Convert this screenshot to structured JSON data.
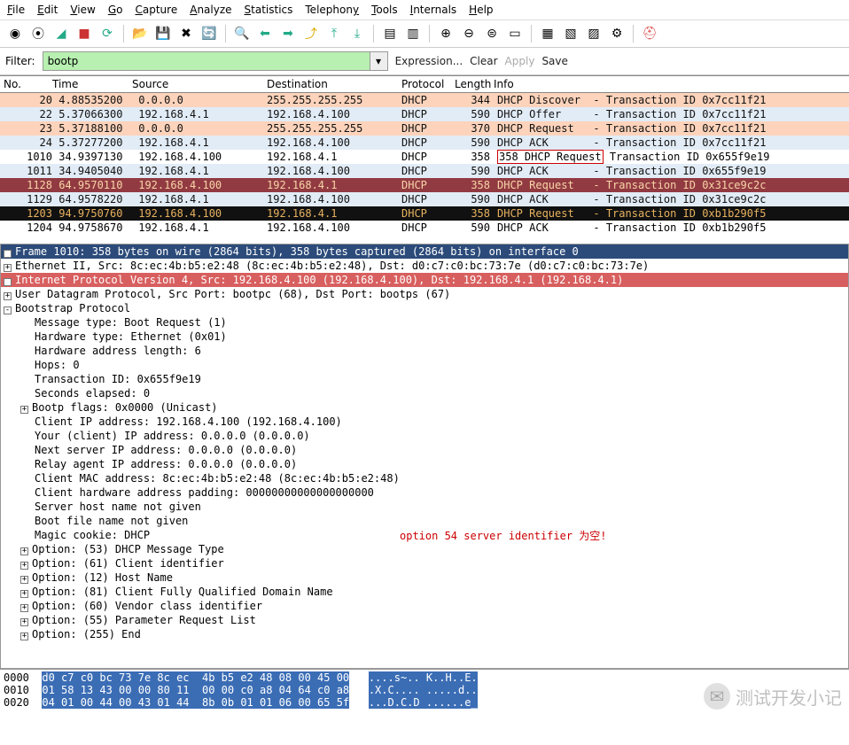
{
  "menu": [
    "File",
    "Edit",
    "View",
    "Go",
    "Capture",
    "Analyze",
    "Statistics",
    "Telephony",
    "Tools",
    "Internals",
    "Help"
  ],
  "filter": {
    "label": "Filter:",
    "value": "bootp",
    "expression": "Expression...",
    "clear": "Clear",
    "apply": "Apply",
    "save": "Save"
  },
  "headers": {
    "no": "No.",
    "time": "Time",
    "source": "Source",
    "destination": "Destination",
    "protocol": "Protocol",
    "length": "Length",
    "info": "Info"
  },
  "packets": [
    {
      "no": "20",
      "time": "4.88535200",
      "src": "0.0.0.0",
      "dst": "255.255.255.255",
      "proto": "DHCP",
      "len": "344",
      "info": "DHCP Discover  - Transaction ID 0x7cc11f21",
      "cls": "row-orange"
    },
    {
      "no": "22",
      "time": "5.37066300",
      "src": "192.168.4.1",
      "dst": "192.168.4.100",
      "proto": "DHCP",
      "len": "590",
      "info": "DHCP Offer     - Transaction ID 0x7cc11f21",
      "cls": "row-blue"
    },
    {
      "no": "23",
      "time": "5.37188100",
      "src": "0.0.0.0",
      "dst": "255.255.255.255",
      "proto": "DHCP",
      "len": "370",
      "info": "DHCP Request   - Transaction ID 0x7cc11f21",
      "cls": "row-orange"
    },
    {
      "no": "24",
      "time": "5.37277200",
      "src": "192.168.4.1",
      "dst": "192.168.4.100",
      "proto": "DHCP",
      "len": "590",
      "info": "DHCP ACK       - Transaction ID 0x7cc11f21",
      "cls": "row-blue"
    },
    {
      "no": "1010",
      "time": "34.9397130",
      "src": "192.168.4.100",
      "dst": "192.168.4.1",
      "proto": "DHCP",
      "len": "358",
      "info": "DHCP Request   - Transaction ID 0x655f9e19",
      "cls": "",
      "hi": true,
      "hitxt": "358 DHCP Request"
    },
    {
      "no": "1011",
      "time": "34.9405040",
      "src": "192.168.4.1",
      "dst": "192.168.4.100",
      "proto": "DHCP",
      "len": "590",
      "info": "DHCP ACK       - Transaction ID 0x655f9e19",
      "cls": "row-blue"
    },
    {
      "no": "1128",
      "time": "64.9570110",
      "src": "192.168.4.100",
      "dst": "192.168.4.1",
      "proto": "DHCP",
      "len": "358",
      "info": "DHCP Request   - Transaction ID 0x31ce9c2c",
      "cls": "row-darkred"
    },
    {
      "no": "1129",
      "time": "64.9578220",
      "src": "192.168.4.1",
      "dst": "192.168.4.100",
      "proto": "DHCP",
      "len": "590",
      "info": "DHCP ACK       - Transaction ID 0x31ce9c2c",
      "cls": "row-blue"
    },
    {
      "no": "1203",
      "time": "94.9750760",
      "src": "192.168.4.100",
      "dst": "192.168.4.1",
      "proto": "DHCP",
      "len": "358",
      "info": "DHCP Request   - Transaction ID 0xb1b290f5",
      "cls": "row-black"
    },
    {
      "no": "1204",
      "time": "94.9758670",
      "src": "192.168.4.1",
      "dst": "192.168.4.100",
      "proto": "DHCP",
      "len": "590",
      "info": "DHCP ACK       - Transaction ID 0xb1b290f5",
      "cls": ""
    }
  ],
  "details": {
    "frame": "Frame 1010: 358 bytes on wire (2864 bits), 358 bytes captured (2864 bits) on interface 0",
    "eth": "Ethernet II, Src: 8c:ec:4b:b5:e2:48 (8c:ec:4b:b5:e2:48), Dst: d0:c7:c0:bc:73:7e (d0:c7:c0:bc:73:7e)",
    "ip": "Internet Protocol Version 4, Src: 192.168.4.100 (192.168.4.100), Dst: 192.168.4.1 (192.168.4.1)",
    "udp": "User Datagram Protocol, Src Port: bootpc (68), Dst Port: bootps (67)",
    "bootp": "Bootstrap Protocol",
    "lines": [
      "Message type: Boot Request (1)",
      "Hardware type: Ethernet (0x01)",
      "Hardware address length: 6",
      "Hops: 0",
      "Transaction ID: 0x655f9e19",
      "Seconds elapsed: 0"
    ],
    "flags": "Bootp flags: 0x0000 (Unicast)",
    "lines2": [
      "Client IP address: 192.168.4.100 (192.168.4.100)",
      "Your (client) IP address: 0.0.0.0 (0.0.0.0)",
      "Next server IP address: 0.0.0.0 (0.0.0.0)",
      "Relay agent IP address: 0.0.0.0 (0.0.0.0)",
      "Client MAC address: 8c:ec:4b:b5:e2:48 (8c:ec:4b:b5:e2:48)",
      "Client hardware address padding: 00000000000000000000",
      "Server host name not given",
      "Boot file name not given",
      "Magic cookie: DHCP"
    ],
    "annotation": "option 54 server identifier 为空!",
    "options": [
      "Option: (53) DHCP Message Type",
      "Option: (61) Client identifier",
      "Option: (12) Host Name",
      "Option: (81) Client Fully Qualified Domain Name",
      "Option: (60) Vendor class identifier",
      "Option: (55) Parameter Request List",
      "Option: (255) End"
    ]
  },
  "hex": {
    "off": [
      "0000",
      "0010",
      "0020"
    ],
    "bytes": [
      "d0 c7 c0 bc 73 7e 8c ec  4b b5 e2 48 08 00 45 00",
      "01 58 13 43 00 00 80 11  00 00 c0 a8 04 64 c0 a8",
      "04 01 00 44 00 43 01 44  8b 0b 01 01 06 00 65 5f"
    ],
    "ascii": [
      "....s~.. K..H..E.",
      ".X.C.... .....d..",
      "...D.C.D ......e_"
    ]
  },
  "watermark": "测试开发小记"
}
